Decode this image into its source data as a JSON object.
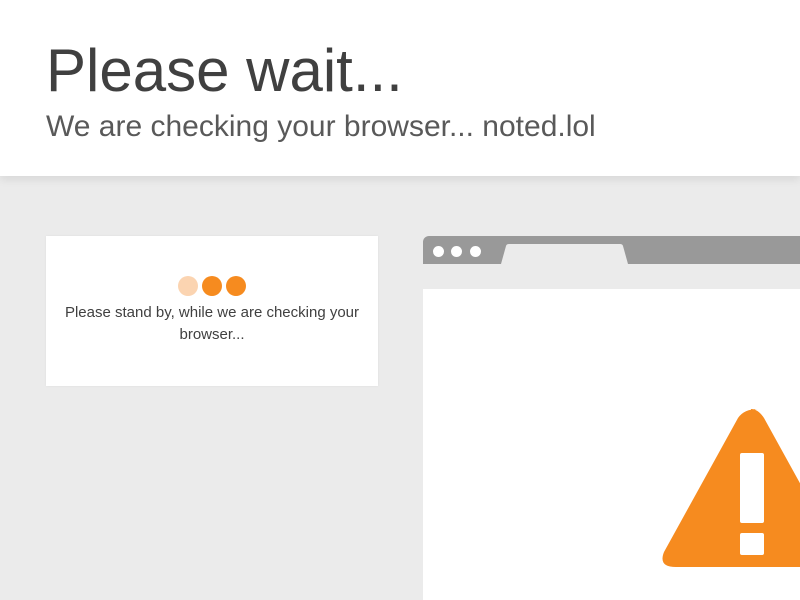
{
  "header": {
    "title": "Please wait...",
    "subtitle": "We are checking your browser... noted.lol"
  },
  "status_card": {
    "message": "Please stand by, while we are checking your browser...",
    "loader_dots": [
      {
        "color": "#fbd4b1",
        "state": "dim"
      },
      {
        "color": "#f68b1f",
        "state": "active"
      },
      {
        "color": "#f68b1f",
        "state": "active"
      }
    ]
  },
  "browser_illustration": {
    "window_control_icons": [
      "window-dot-icon",
      "window-dot-icon",
      "window-dot-icon"
    ],
    "warning_icon": "warning-triangle-icon"
  },
  "colors": {
    "accent": "#f68b1f",
    "accent_light": "#fbd4b1",
    "background": "#ebebeb",
    "browser_chrome": "#999999",
    "title_text": "#404040",
    "subtitle_text": "#595959"
  }
}
